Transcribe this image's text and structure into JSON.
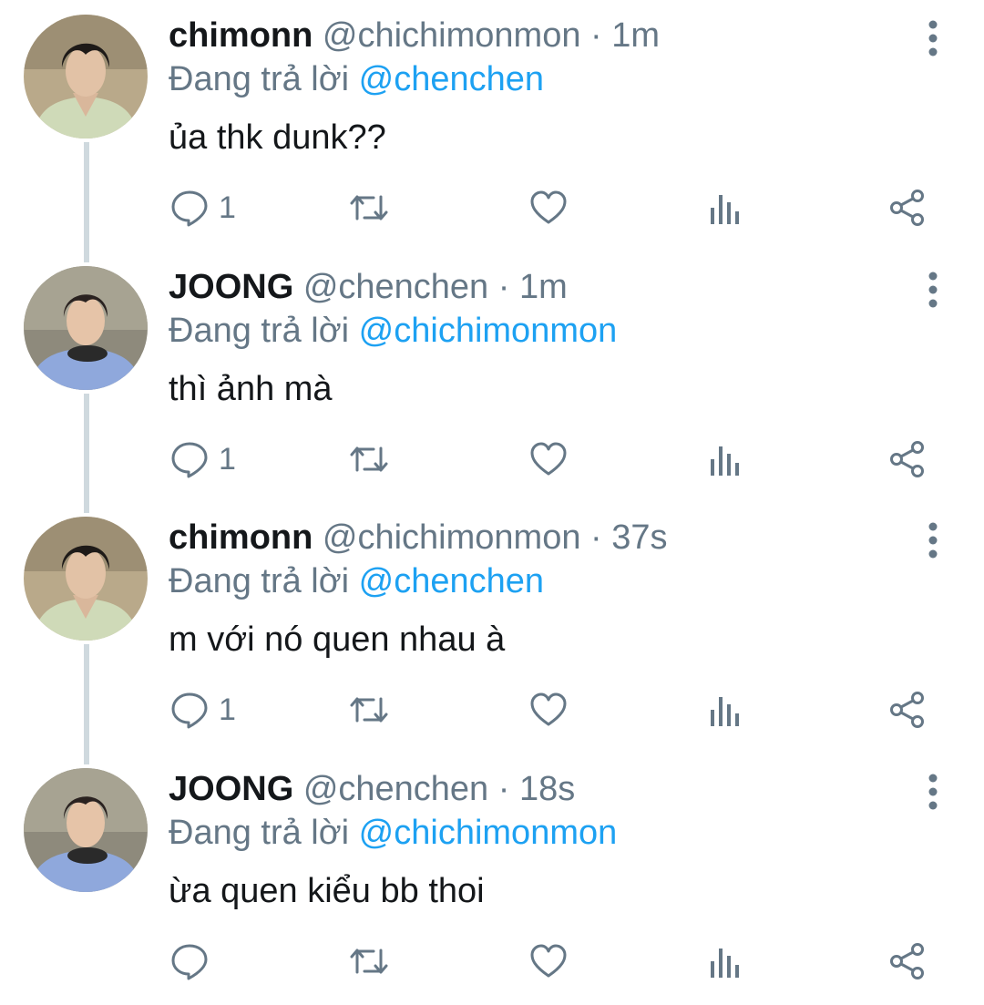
{
  "tweets": [
    {
      "display_name": "chimonn",
      "handle": "@chichimonmon",
      "separator": "·",
      "time": "1m",
      "reply_prefix": "Đang trả lời",
      "reply_to": "@chenchen",
      "text": "ủa thk dunk??",
      "reply_count": "1",
      "avatar": "avatar-chimonn"
    },
    {
      "display_name": "JOONG",
      "handle": "@chenchen",
      "separator": "·",
      "time": "1m",
      "reply_prefix": "Đang trả lời",
      "reply_to": "@chichimonmon",
      "text": "thì ảnh mà",
      "reply_count": "1",
      "avatar": "avatar-joong"
    },
    {
      "display_name": "chimonn",
      "handle": "@chichimonmon",
      "separator": "·",
      "time": "37s",
      "reply_prefix": "Đang trả lời",
      "reply_to": "@chenchen",
      "text": "m với nó quen nhau à",
      "reply_count": "1",
      "avatar": "avatar-chimonn"
    },
    {
      "display_name": "JOONG",
      "handle": "@chenchen",
      "separator": "·",
      "time": "18s",
      "reply_prefix": "Đang trả lời",
      "reply_to": "@chichimonmon",
      "text": "ừa quen kiểu bb thoi",
      "reply_count": "",
      "avatar": "avatar-joong"
    }
  ],
  "icons": {
    "more": "more-vertical-icon",
    "reply": "reply-icon",
    "retweet": "retweet-icon",
    "like": "heart-icon",
    "stats": "stats-icon",
    "share": "share-icon"
  },
  "colors": {
    "text": "#14171a",
    "secondary": "#657786",
    "mention": "#1da1f2",
    "thread_line": "#cfd9de"
  }
}
